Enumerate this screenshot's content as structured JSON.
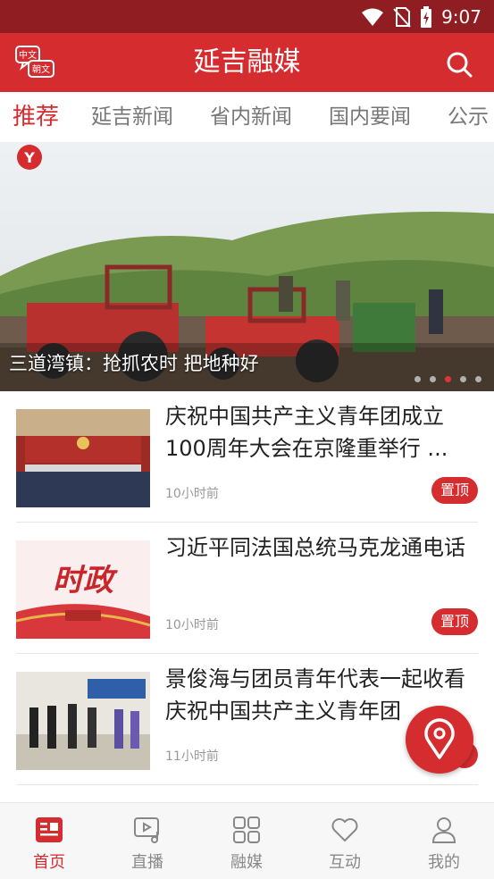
{
  "status_bar": {
    "time": "9:07"
  },
  "app_bar": {
    "title": "延吉融媒",
    "lang_icon_top": "中文",
    "lang_icon_bottom": "朝文"
  },
  "tabs": [
    {
      "label": "推荐",
      "active": true
    },
    {
      "label": "延吉新闻"
    },
    {
      "label": "省内新闻"
    },
    {
      "label": "国内要闻"
    },
    {
      "label": "公示"
    }
  ],
  "banner": {
    "caption": "三道湾镇：抢抓农时 把地种好",
    "logo_text": "Y",
    "dot_count": 5,
    "active_dot": 2
  },
  "news": [
    {
      "headline": "庆祝中国共产主义青年团成立100周年大会在京隆重举行 ...",
      "time": "10小时前",
      "badge": "置顶"
    },
    {
      "headline": "习近平同法国总统马克龙通电话",
      "time": "10小时前",
      "badge": "置顶",
      "thumb_text": "时政"
    },
    {
      "headline": "景俊海与团员青年代表一起收看庆祝中国共产主义青年团",
      "time": "11小时前"
    }
  ],
  "bottom_nav": [
    {
      "label": "首页",
      "icon": "home-news-icon",
      "active": true
    },
    {
      "label": "直播",
      "icon": "live-video-icon"
    },
    {
      "label": "融媒",
      "icon": "grid-apps-icon"
    },
    {
      "label": "互动",
      "icon": "heart-icon"
    },
    {
      "label": "我的",
      "icon": "user-icon"
    }
  ],
  "colors": {
    "brand": "#d42c2f",
    "status_bar": "#8f1d22"
  }
}
